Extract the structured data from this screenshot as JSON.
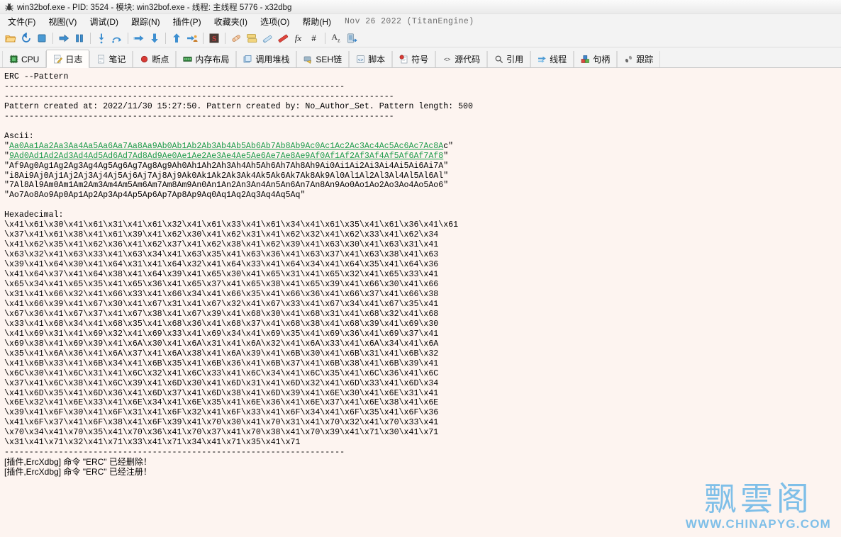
{
  "window": {
    "title": "win32bof.exe - PID: 3524 - 模块: win32bof.exe - 线程: 主线程 5776 - x32dbg",
    "icon": "bug-icon"
  },
  "menu": {
    "items": [
      {
        "label": "文件(F)",
        "name": "menu-file"
      },
      {
        "label": "视图(V)",
        "name": "menu-view"
      },
      {
        "label": "调试(D)",
        "name": "menu-debug"
      },
      {
        "label": "跟踪(N)",
        "name": "menu-trace"
      },
      {
        "label": "插件(P)",
        "name": "menu-plugins"
      },
      {
        "label": "收藏夹(I)",
        "name": "menu-favourites"
      },
      {
        "label": "选项(O)",
        "name": "menu-options"
      },
      {
        "label": "帮助(H)",
        "name": "menu-help"
      }
    ],
    "engine": "Nov 26 2022 (TitanEngine)"
  },
  "toolbar": {
    "buttons": [
      {
        "name": "open-file-icon",
        "glyph": "folder"
      },
      {
        "name": "restart-icon",
        "glyph": "restart"
      },
      {
        "name": "stop-icon",
        "glyph": "stop"
      },
      {
        "sep": true
      },
      {
        "name": "run-icon",
        "glyph": "run"
      },
      {
        "name": "pause-icon",
        "glyph": "pause"
      },
      {
        "sep": true
      },
      {
        "name": "step-into-icon",
        "glyph": "stepinto"
      },
      {
        "name": "step-over-icon",
        "glyph": "stepover"
      },
      {
        "sep": true
      },
      {
        "name": "trace-into-icon",
        "glyph": "traceinto"
      },
      {
        "name": "trace-over-icon",
        "glyph": "traceover"
      },
      {
        "sep": true
      },
      {
        "name": "execute-till-return-icon",
        "glyph": "tillreturn"
      },
      {
        "name": "execute-till-user-code-icon",
        "glyph": "tilluser"
      },
      {
        "sep": true
      },
      {
        "name": "scylla-icon",
        "glyph": "scylla"
      },
      {
        "sep": true
      },
      {
        "name": "patch-icon",
        "glyph": "patch"
      },
      {
        "name": "log-window-icon",
        "glyph": "logwin"
      },
      {
        "name": "comment-icon",
        "glyph": "comment"
      },
      {
        "name": "bookmark-icon",
        "glyph": "bookmark"
      },
      {
        "name": "function-icon",
        "glyph": "fx"
      },
      {
        "name": "label-icon",
        "glyph": "hash"
      },
      {
        "sep": true
      },
      {
        "name": "font-icon",
        "glyph": "az"
      },
      {
        "name": "attach-icon",
        "glyph": "attach"
      }
    ]
  },
  "tabs": [
    {
      "label": "CPU",
      "icon": "cpu-icon",
      "active": false
    },
    {
      "label": "日志",
      "icon": "log-icon",
      "active": true
    },
    {
      "label": "笔记",
      "icon": "notes-icon",
      "active": false
    },
    {
      "label": "断点",
      "icon": "breakpoint-icon",
      "active": false
    },
    {
      "label": "内存布局",
      "icon": "memory-map-icon",
      "active": false
    },
    {
      "label": "调用堆栈",
      "icon": "call-stack-icon",
      "active": false
    },
    {
      "label": "SEH链",
      "icon": "seh-chain-icon",
      "active": false
    },
    {
      "label": "脚本",
      "icon": "script-icon",
      "active": false
    },
    {
      "label": "符号",
      "icon": "symbols-icon",
      "active": false
    },
    {
      "label": "源代码",
      "icon": "source-icon",
      "active": false
    },
    {
      "label": "引用",
      "icon": "references-icon",
      "active": false
    },
    {
      "label": "线程",
      "icon": "threads-icon",
      "active": false
    },
    {
      "label": "句柄",
      "icon": "handles-icon",
      "active": false
    },
    {
      "label": "跟踪",
      "icon": "trace-icon",
      "active": false
    }
  ],
  "log": {
    "lines": [
      {
        "type": "plain",
        "text": "ERC --Pattern"
      },
      {
        "type": "plain",
        "text": "---------------------------------------------------------------------"
      },
      {
        "type": "plain",
        "text": "-------------------------------------------------------------------------------"
      },
      {
        "type": "plain",
        "text": "Pattern created at: 2022/11/30 15:27:50. Pattern created by: No_Author_Set. Pattern length: 500"
      },
      {
        "type": "plain",
        "text": "-------------------------------------------------------------------------------"
      },
      {
        "type": "blank",
        "text": " "
      },
      {
        "type": "plain",
        "text": "Ascii:"
      },
      {
        "type": "green",
        "pre": "\"",
        "green": "Aa0Aa1Aa2Aa3Aa4Aa5Aa6Aa7Aa8Aa9Ab0Ab1Ab2Ab3Ab4Ab5Ab6Ab7Ab8Ab9Ac0Ac1Ac2Ac3Ac4Ac5Ac6Ac7Ac8A",
        "post": "c\""
      },
      {
        "type": "green",
        "pre": "\"",
        "green": "9Ad0Ad1Ad2Ad3Ad4Ad5Ad6Ad7Ad8Ad9Ae0Ae1Ae2Ae3Ae4Ae5Ae6Ae7Ae8Ae9Af0Af1Af2Af3Af4Af5Af6Af7Af8",
        "post": "\""
      },
      {
        "type": "plain",
        "text": "\"Af9Ag0Ag1Ag2Ag3Ag4Ag5Ag6Ag7Ag8Ag9Ah0Ah1Ah2Ah3Ah4Ah5Ah6Ah7Ah8Ah9Ai0Ai1Ai2Ai3Ai4Ai5Ai6Ai7A\""
      },
      {
        "type": "plain",
        "text": "\"i8Ai9Aj0Aj1Aj2Aj3Aj4Aj5Aj6Aj7Aj8Aj9Ak0Ak1Ak2Ak3Ak4Ak5Ak6Ak7Ak8Ak9Al0Al1Al2Al3Al4Al5Al6Al\""
      },
      {
        "type": "plain",
        "text": "\"7Al8Al9Am0Am1Am2Am3Am4Am5Am6Am7Am8Am9An0An1An2An3An4An5An6An7An8An9Ao0Ao1Ao2Ao3Ao4Ao5Ao6\""
      },
      {
        "type": "plain",
        "text": "\"Ao7Ao8Ao9Ap0Ap1Ap2Ap3Ap4Ap5Ap6Ap7Ap8Ap9Aq0Aq1Aq2Aq3Aq4Aq5Aq\""
      },
      {
        "type": "blank",
        "text": " "
      },
      {
        "type": "plain",
        "text": "Hexadecimal:"
      },
      {
        "type": "plain",
        "text": "\\x41\\x61\\x30\\x41\\x61\\x31\\x41\\x61\\x32\\x41\\x61\\x33\\x41\\x61\\x34\\x41\\x61\\x35\\x41\\x61\\x36\\x41\\x61"
      },
      {
        "type": "plain",
        "text": "\\x37\\x41\\x61\\x38\\x41\\x61\\x39\\x41\\x62\\x30\\x41\\x62\\x31\\x41\\x62\\x32\\x41\\x62\\x33\\x41\\x62\\x34"
      },
      {
        "type": "plain",
        "text": "\\x41\\x62\\x35\\x41\\x62\\x36\\x41\\x62\\x37\\x41\\x62\\x38\\x41\\x62\\x39\\x41\\x63\\x30\\x41\\x63\\x31\\x41"
      },
      {
        "type": "plain",
        "text": "\\x63\\x32\\x41\\x63\\x33\\x41\\x63\\x34\\x41\\x63\\x35\\x41\\x63\\x36\\x41\\x63\\x37\\x41\\x63\\x38\\x41\\x63"
      },
      {
        "type": "plain",
        "text": "\\x39\\x41\\x64\\x30\\x41\\x64\\x31\\x41\\x64\\x32\\x41\\x64\\x33\\x41\\x64\\x34\\x41\\x64\\x35\\x41\\x64\\x36"
      },
      {
        "type": "plain",
        "text": "\\x41\\x64\\x37\\x41\\x64\\x38\\x41\\x64\\x39\\x41\\x65\\x30\\x41\\x65\\x31\\x41\\x65\\x32\\x41\\x65\\x33\\x41"
      },
      {
        "type": "plain",
        "text": "\\x65\\x34\\x41\\x65\\x35\\x41\\x65\\x36\\x41\\x65\\x37\\x41\\x65\\x38\\x41\\x65\\x39\\x41\\x66\\x30\\x41\\x66"
      },
      {
        "type": "plain",
        "text": "\\x31\\x41\\x66\\x32\\x41\\x66\\x33\\x41\\x66\\x34\\x41\\x66\\x35\\x41\\x66\\x36\\x41\\x66\\x37\\x41\\x66\\x38"
      },
      {
        "type": "plain",
        "text": "\\x41\\x66\\x39\\x41\\x67\\x30\\x41\\x67\\x31\\x41\\x67\\x32\\x41\\x67\\x33\\x41\\x67\\x34\\x41\\x67\\x35\\x41"
      },
      {
        "type": "plain",
        "text": "\\x67\\x36\\x41\\x67\\x37\\x41\\x67\\x38\\x41\\x67\\x39\\x41\\x68\\x30\\x41\\x68\\x31\\x41\\x68\\x32\\x41\\x68"
      },
      {
        "type": "plain",
        "text": "\\x33\\x41\\x68\\x34\\x41\\x68\\x35\\x41\\x68\\x36\\x41\\x68\\x37\\x41\\x68\\x38\\x41\\x68\\x39\\x41\\x69\\x30"
      },
      {
        "type": "plain",
        "text": "\\x41\\x69\\x31\\x41\\x69\\x32\\x41\\x69\\x33\\x41\\x69\\x34\\x41\\x69\\x35\\x41\\x69\\x36\\x41\\x69\\x37\\x41"
      },
      {
        "type": "plain",
        "text": "\\x69\\x38\\x41\\x69\\x39\\x41\\x6A\\x30\\x41\\x6A\\x31\\x41\\x6A\\x32\\x41\\x6A\\x33\\x41\\x6A\\x34\\x41\\x6A"
      },
      {
        "type": "plain",
        "text": "\\x35\\x41\\x6A\\x36\\x41\\x6A\\x37\\x41\\x6A\\x38\\x41\\x6A\\x39\\x41\\x6B\\x30\\x41\\x6B\\x31\\x41\\x6B\\x32"
      },
      {
        "type": "plain",
        "text": "\\x41\\x6B\\x33\\x41\\x6B\\x34\\x41\\x6B\\x35\\x41\\x6B\\x36\\x41\\x6B\\x37\\x41\\x6B\\x38\\x41\\x6B\\x39\\x41"
      },
      {
        "type": "plain",
        "text": "\\x6C\\x30\\x41\\x6C\\x31\\x41\\x6C\\x32\\x41\\x6C\\x33\\x41\\x6C\\x34\\x41\\x6C\\x35\\x41\\x6C\\x36\\x41\\x6C"
      },
      {
        "type": "plain",
        "text": "\\x37\\x41\\x6C\\x38\\x41\\x6C\\x39\\x41\\x6D\\x30\\x41\\x6D\\x31\\x41\\x6D\\x32\\x41\\x6D\\x33\\x41\\x6D\\x34"
      },
      {
        "type": "plain",
        "text": "\\x41\\x6D\\x35\\x41\\x6D\\x36\\x41\\x6D\\x37\\x41\\x6D\\x38\\x41\\x6D\\x39\\x41\\x6E\\x30\\x41\\x6E\\x31\\x41"
      },
      {
        "type": "plain",
        "text": "\\x6E\\x32\\x41\\x6E\\x33\\x41\\x6E\\x34\\x41\\x6E\\x35\\x41\\x6E\\x36\\x41\\x6E\\x37\\x41\\x6E\\x38\\x41\\x6E"
      },
      {
        "type": "plain",
        "text": "\\x39\\x41\\x6F\\x30\\x41\\x6F\\x31\\x41\\x6F\\x32\\x41\\x6F\\x33\\x41\\x6F\\x34\\x41\\x6F\\x35\\x41\\x6F\\x36"
      },
      {
        "type": "plain",
        "text": "\\x41\\x6F\\x37\\x41\\x6F\\x38\\x41\\x6F\\x39\\x41\\x70\\x30\\x41\\x70\\x31\\x41\\x70\\x32\\x41\\x70\\x33\\x41"
      },
      {
        "type": "plain",
        "text": "\\x70\\x34\\x41\\x70\\x35\\x41\\x70\\x36\\x41\\x70\\x37\\x41\\x70\\x38\\x41\\x70\\x39\\x41\\x71\\x30\\x41\\x71"
      },
      {
        "type": "plain",
        "text": "\\x31\\x41\\x71\\x32\\x41\\x71\\x33\\x41\\x71\\x34\\x41\\x71\\x35\\x41\\x71"
      },
      {
        "type": "plain",
        "text": "---------------------------------------------------------------------"
      },
      {
        "type": "cn",
        "text": "[插件,ErcXdbg] 命令 \"ERC\" 已经删除！"
      },
      {
        "type": "cn",
        "text": "[插件,ErcXdbg] 命令 \"ERC\" 已经注册！"
      }
    ]
  },
  "watermark": {
    "cn": "飘雲阁",
    "url": "WWW.CHINAPYG.COM",
    "color": "#7fbfe8"
  },
  "colors": {
    "log_background": "#fdf4f0",
    "green_text": "#1a9a48",
    "chrome": "#f3f3f3"
  }
}
